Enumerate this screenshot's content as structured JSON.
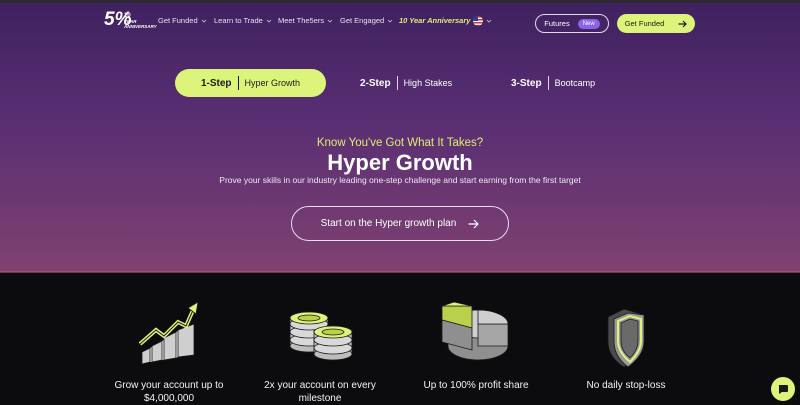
{
  "nav": {
    "logo": {
      "number": "5%",
      "badge": "10",
      "tagline": "YEAR ANNIVERSARY"
    },
    "items": [
      {
        "label": "Get Funded"
      },
      {
        "label": "Learn to Trade"
      },
      {
        "label": "Meet The5ers"
      },
      {
        "label": "Get Engaged"
      }
    ],
    "anniversary": "10 Year Anniversary",
    "futures_label": "Futures",
    "new_badge": "New",
    "get_funded_button": "Get Funded"
  },
  "steps": [
    {
      "number": "1-Step",
      "name": "Hyper Growth",
      "active": true
    },
    {
      "number": "2-Step",
      "name": "High Stakes",
      "active": false
    },
    {
      "number": "3-Step",
      "name": "Bootcamp",
      "active": false
    }
  ],
  "hero": {
    "tagline": "Know You've Got What It Takes?",
    "title": "Hyper Growth",
    "subtitle": "Prove your skills in our industry leading one-step challenge and start earning from the first target",
    "cta": "Start on the Hyper growth plan"
  },
  "features": [
    {
      "icon": "growth-chart-icon",
      "line1": "Grow your account up to",
      "line2": "$4,000,000"
    },
    {
      "icon": "coins-stack-icon",
      "line1": "2x your account on every",
      "line2": "milestone"
    },
    {
      "icon": "pie-chart-icon",
      "line1": "Up to 100% profit share",
      "line2": ""
    },
    {
      "icon": "shield-icon",
      "line1": "No daily stop-loss",
      "line2": ""
    }
  ],
  "colors": {
    "accent": "#dcf47a",
    "hero_top": "#3f2160",
    "hero_bottom": "#7f4170",
    "dark_section": "#0c0b0d",
    "new_badge": "#8a63e6"
  }
}
